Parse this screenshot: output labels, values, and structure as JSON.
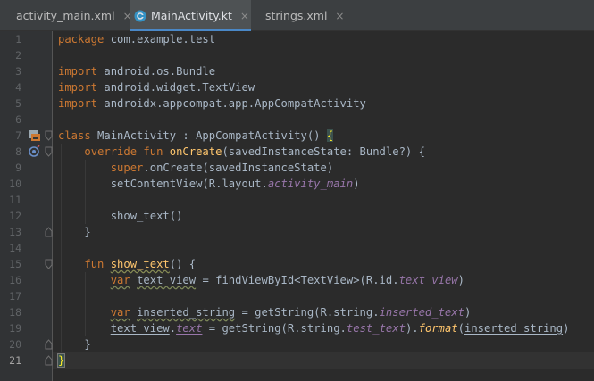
{
  "tabs": [
    {
      "label": "activity_main.xml",
      "icon": "xml-layout-file-icon",
      "active": false
    },
    {
      "label": "MainActivity.kt",
      "icon": "kotlin-class-file-icon",
      "active": true
    },
    {
      "label": "strings.xml",
      "icon": "xml-values-file-icon",
      "active": false
    }
  ],
  "tab_close_glyph": "×",
  "current_line": 21,
  "colors": {
    "background": "#2b2b2b",
    "keyword": "#cc7832",
    "function": "#ffc66d",
    "property": "#9876aa",
    "text": "#a9b7c6",
    "tab_active_underline": "#4a88c7"
  },
  "lines": [
    {
      "n": "1",
      "t": [
        [
          "k",
          "package "
        ],
        [
          "",
          "com.example.test"
        ]
      ]
    },
    {
      "n": "2",
      "t": []
    },
    {
      "n": "3",
      "t": [
        [
          "k",
          "import "
        ],
        [
          "",
          "android.os.Bundle"
        ]
      ]
    },
    {
      "n": "4",
      "t": [
        [
          "k",
          "import "
        ],
        [
          "",
          "android.widget.TextView"
        ]
      ]
    },
    {
      "n": "5",
      "t": [
        [
          "k",
          "import "
        ],
        [
          "",
          "androidx.appcompat.app.AppCompatActivity"
        ]
      ]
    },
    {
      "n": "6",
      "t": []
    },
    {
      "n": "7",
      "t": [
        [
          "k",
          "class "
        ],
        [
          "",
          "MainActivity : AppCompatActivity() "
        ],
        [
          "bm",
          "{"
        ]
      ]
    },
    {
      "n": "8",
      "t": [
        [
          "",
          "    "
        ],
        [
          "k",
          "override fun "
        ],
        [
          "fn",
          "onCreate"
        ],
        [
          "",
          "(savedInstanceState: Bundle?) {"
        ]
      ]
    },
    {
      "n": "9",
      "t": [
        [
          "",
          "        "
        ],
        [
          "k",
          "super"
        ],
        [
          "",
          "."
        ],
        [
          "",
          "onCreate(savedInstanceState)"
        ]
      ]
    },
    {
      "n": "10",
      "t": [
        [
          "",
          "        "
        ],
        [
          "",
          "setContentView(R.layout."
        ],
        [
          "ital",
          "activity_main"
        ],
        [
          "",
          ")"
        ]
      ]
    },
    {
      "n": "11",
      "t": []
    },
    {
      "n": "12",
      "t": [
        [
          "",
          "        "
        ],
        [
          "",
          "show_text()"
        ]
      ]
    },
    {
      "n": "13",
      "t": [
        [
          "",
          "    "
        ],
        [
          "",
          "}"
        ]
      ]
    },
    {
      "n": "14",
      "t": []
    },
    {
      "n": "15",
      "t": [
        [
          "",
          "    "
        ],
        [
          "k",
          "fun "
        ],
        [
          "fnc",
          "show_text"
        ],
        [
          "",
          "() {"
        ]
      ]
    },
    {
      "n": "16",
      "t": [
        [
          "",
          "        "
        ],
        [
          "kwavy",
          "var"
        ],
        [
          "",
          " "
        ],
        [
          "wavy",
          "text_view"
        ],
        [
          "",
          " = findViewById<TextView>(R.id."
        ],
        [
          "ital",
          "text_view"
        ],
        [
          "",
          ")"
        ]
      ]
    },
    {
      "n": "17",
      "t": []
    },
    {
      "n": "18",
      "t": [
        [
          "",
          "        "
        ],
        [
          "kwavy",
          "var"
        ],
        [
          "",
          " "
        ],
        [
          "wavy",
          "inserted_string"
        ],
        [
          "",
          " = getString(R.string."
        ],
        [
          "ital",
          "inserted_text"
        ],
        [
          "",
          ")"
        ]
      ]
    },
    {
      "n": "19",
      "t": [
        [
          "",
          "        "
        ],
        [
          "ul",
          "text_view"
        ],
        [
          "",
          "."
        ],
        [
          "italul",
          "text"
        ],
        [
          "",
          " = getString(R.string."
        ],
        [
          "ital",
          "test_text"
        ],
        [
          "",
          ")."
        ],
        [
          "itfn",
          "format"
        ],
        [
          "",
          "("
        ],
        [
          "ul",
          "inserted_string"
        ],
        [
          "",
          ")"
        ]
      ]
    },
    {
      "n": "20",
      "t": [
        [
          "",
          "    "
        ],
        [
          "",
          "}"
        ]
      ]
    },
    {
      "n": "21",
      "t": [
        [
          "bmc",
          "}"
        ]
      ]
    }
  ],
  "gutter_icons": [
    {
      "line": 7,
      "name": "android-activity-icon",
      "glyph": "▣"
    },
    {
      "line": 8,
      "name": "override-marker-icon",
      "glyph": "◉"
    }
  ]
}
